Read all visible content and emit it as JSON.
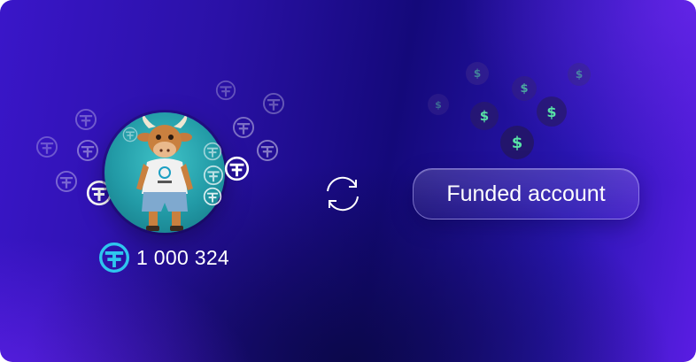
{
  "balance": {
    "icon": "token-icon",
    "amount": "1 000 324"
  },
  "action": {
    "icon": "swap-icon"
  },
  "funded": {
    "label": "Funded account"
  },
  "dollar_symbol": "$",
  "colors": {
    "background": "#1a0c8c",
    "accent_purple": "#6a1ff0",
    "token_cyan": "#2ec6ee",
    "dollar_green": "#58e3a6",
    "avatar_teal": "#2aa3ad"
  }
}
